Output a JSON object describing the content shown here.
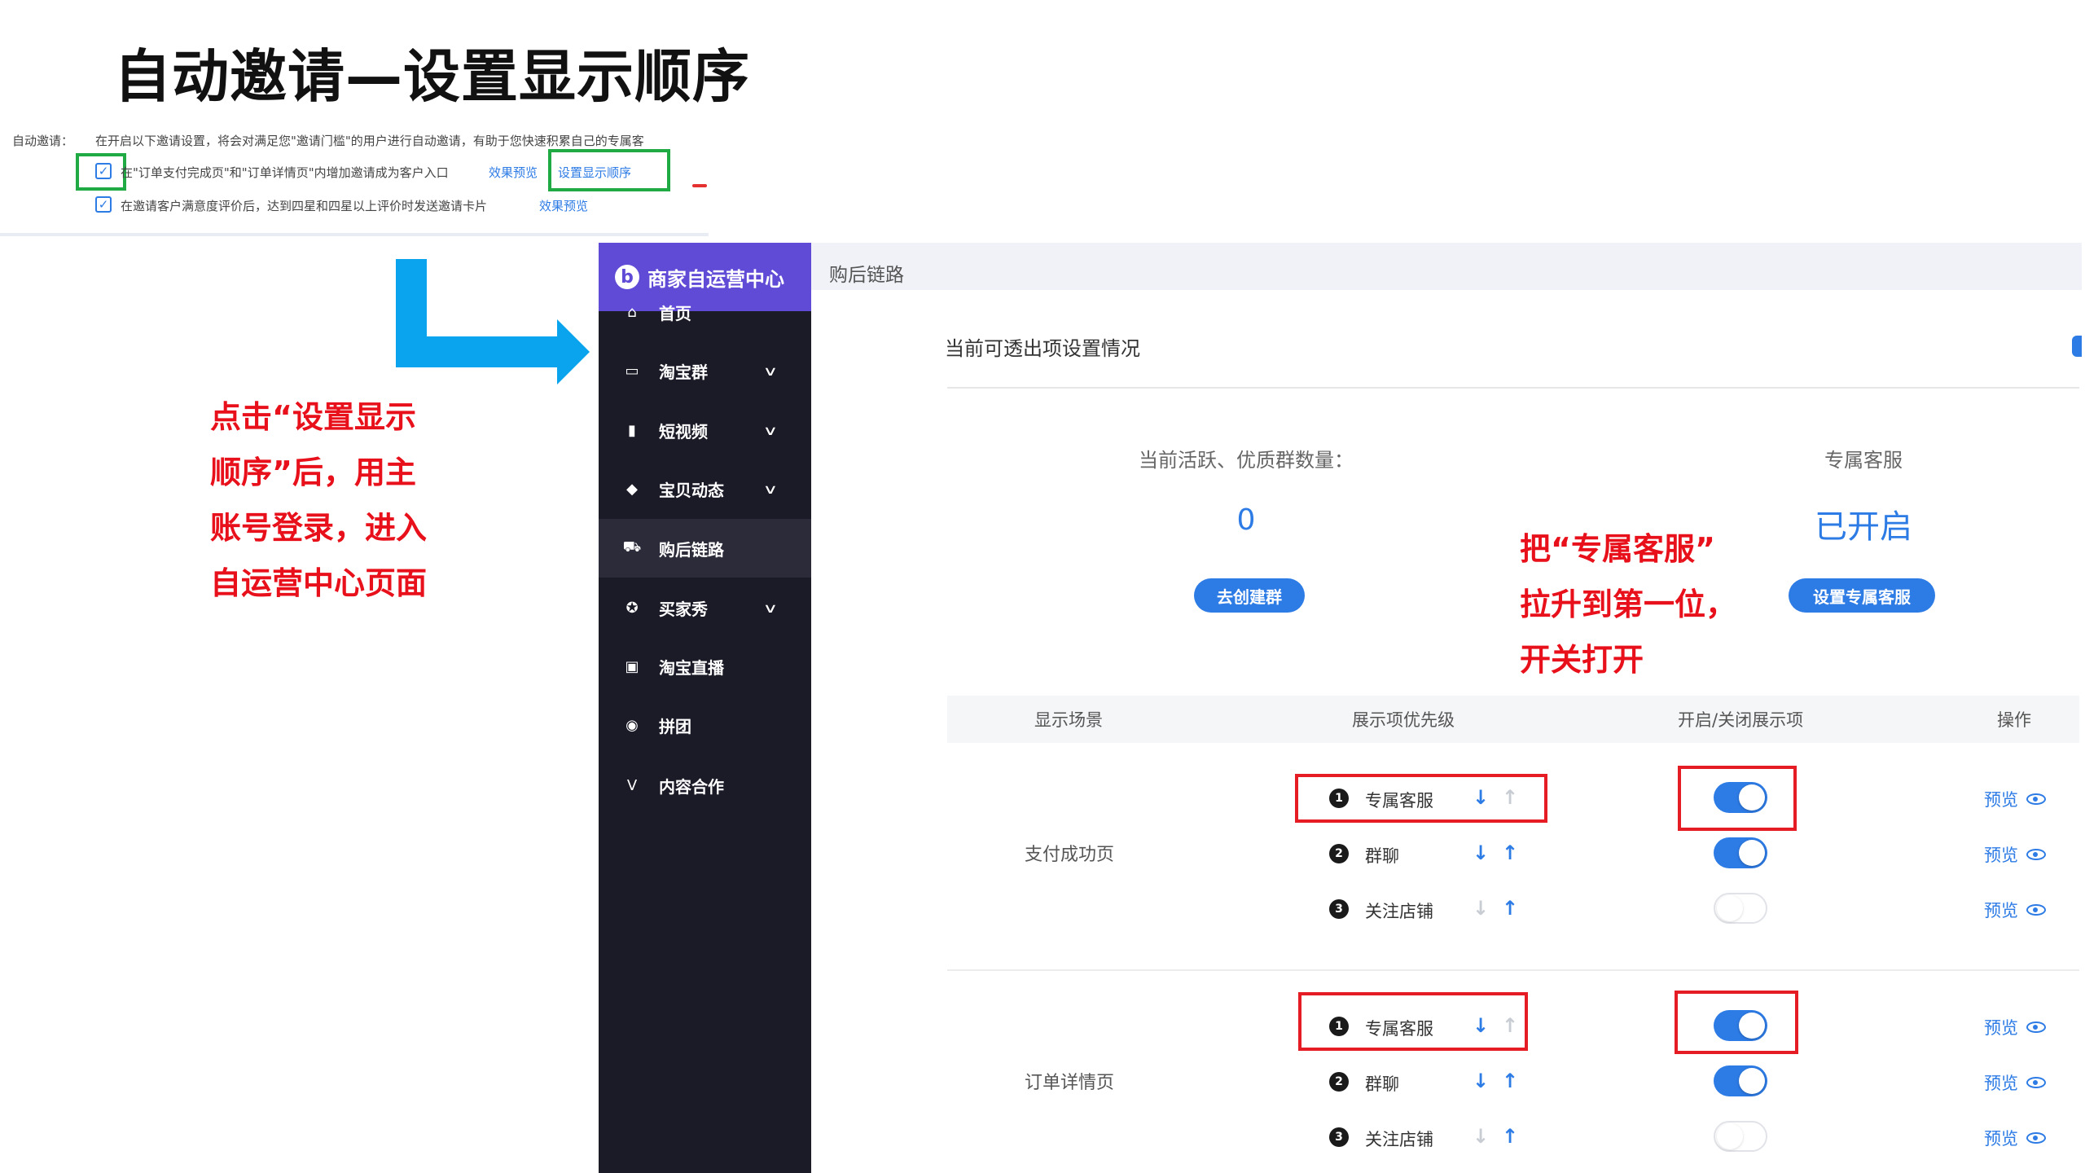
{
  "slide": {
    "title": "自动邀请—设置显示顺序"
  },
  "invite_settings": {
    "label": "自动邀请：",
    "description": "在开启以下邀请设置，将会对满足您\"邀请门槛\"的用户进行自动邀请，有助于您快速积累自己的专属客",
    "options": [
      {
        "text": "在\"订单支付完成页\"和\"订单详情页\"内增加邀请成为客户入口",
        "checked": true,
        "link1": "效果预览",
        "link2": "设置显示顺序"
      },
      {
        "text": "在邀请客户满意度评价后，达到四星和四星以上评价时发送邀请卡片",
        "checked": true,
        "link1": "效果预览"
      }
    ]
  },
  "annotations": {
    "left_lines": [
      "点击“设置显示",
      "顺序”后，用主",
      "账号登录，进入",
      "自运营中心页面"
    ],
    "right_lines": [
      "把“专属客服”",
      "拉升到第一位，",
      "开关打开"
    ],
    "highlight_color": "#e8101a"
  },
  "sidebar": {
    "title": "商家自运营中心",
    "logo": "b",
    "items": [
      {
        "label": "首页",
        "icon": "home-icon",
        "glyph": "⌂",
        "chevron": false,
        "active": false
      },
      {
        "label": "淘宝群",
        "icon": "chat-icon",
        "glyph": "▭",
        "chevron": true,
        "active": false
      },
      {
        "label": "短视频",
        "icon": "video-icon",
        "glyph": "▮",
        "chevron": true,
        "active": false
      },
      {
        "label": "宝贝动态",
        "icon": "bag-icon",
        "glyph": "◆",
        "chevron": true,
        "active": false
      },
      {
        "label": "购后链路",
        "icon": "cart-icon",
        "glyph": "⛟",
        "chevron": false,
        "active": true
      },
      {
        "label": "买家秀",
        "icon": "star-icon",
        "glyph": "✪",
        "chevron": true,
        "active": false
      },
      {
        "label": "淘宝直播",
        "icon": "live-icon",
        "glyph": "▣",
        "chevron": false,
        "active": false
      },
      {
        "label": "拼团",
        "icon": "group-icon",
        "glyph": "◉",
        "chevron": false,
        "active": false
      },
      {
        "label": "内容合作",
        "icon": "content-icon",
        "glyph": "V",
        "chevron": false,
        "active": false
      }
    ],
    "chevron_glyph": "∨"
  },
  "main": {
    "breadcrumb": "购后链路",
    "section_title": "当前可透出项设置情况",
    "stats": {
      "groups_label": "当前活跃、优质群数量：",
      "groups_value": "0",
      "groups_button": "去创建群",
      "service_label": "专属客服",
      "service_value": "已开启",
      "service_button": "设置专属客服"
    },
    "table": {
      "headers": [
        "显示场景",
        "展示项优先级",
        "开启/关闭展示项",
        "操作"
      ],
      "sections": [
        {
          "scene": "支付成功页",
          "rows": [
            {
              "num": "1",
              "label": "专属客服",
              "down": true,
              "up": false,
              "toggle": true,
              "action": "预览"
            },
            {
              "num": "2",
              "label": "群聊",
              "down": true,
              "up": true,
              "toggle": true,
              "action": "预览"
            },
            {
              "num": "3",
              "label": "关注店铺",
              "down": false,
              "up": true,
              "toggle": false,
              "action": "预览"
            }
          ]
        },
        {
          "scene": "订单详情页",
          "rows": [
            {
              "num": "1",
              "label": "专属客服",
              "down": true,
              "up": false,
              "toggle": true,
              "action": "预览"
            },
            {
              "num": "2",
              "label": "群聊",
              "down": true,
              "up": true,
              "toggle": true,
              "action": "预览"
            },
            {
              "num": "3",
              "label": "关注店铺",
              "down": false,
              "up": true,
              "toggle": false,
              "action": "预览"
            }
          ]
        }
      ],
      "arrow_down": "↓",
      "arrow_up": "↑"
    }
  }
}
